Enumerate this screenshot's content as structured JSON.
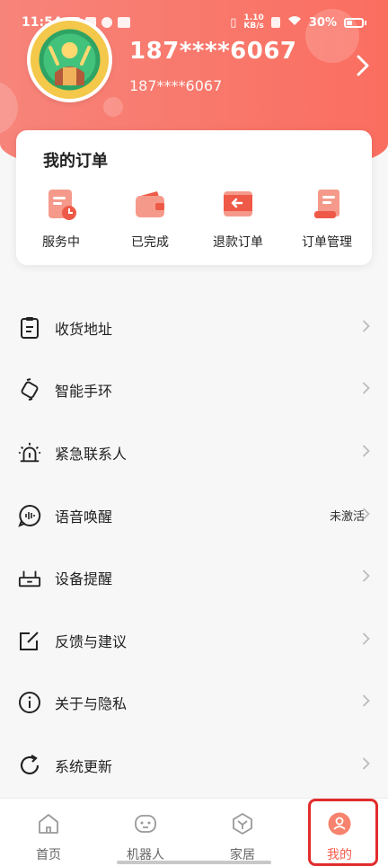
{
  "status_bar": {
    "time": "11:54",
    "speed": "1.10",
    "speed_unit": "KB/s",
    "battery": "30%"
  },
  "profile": {
    "phone_main": "187****6067",
    "phone_sub": "187****6067"
  },
  "orders": {
    "title": "我的订单",
    "items": [
      {
        "label": "服务中",
        "icon": "service-in-progress-icon"
      },
      {
        "label": "已完成",
        "icon": "completed-wallet-icon"
      },
      {
        "label": "退款订单",
        "icon": "refund-icon"
      },
      {
        "label": "订单管理",
        "icon": "order-management-icon"
      }
    ]
  },
  "menu": {
    "items": [
      {
        "label": "收货地址",
        "icon": "clipboard-icon",
        "status": ""
      },
      {
        "label": "智能手环",
        "icon": "smart-band-icon",
        "status": ""
      },
      {
        "label": "紧急联系人",
        "icon": "alarm-light-icon",
        "status": ""
      },
      {
        "label": "语音唤醒",
        "icon": "voice-icon",
        "status": "未激活"
      },
      {
        "label": "设备提醒",
        "icon": "device-icon",
        "status": ""
      },
      {
        "label": "反馈与建议",
        "icon": "feedback-edit-icon",
        "status": ""
      },
      {
        "label": "关于与隐私",
        "icon": "info-icon",
        "status": ""
      },
      {
        "label": "系统更新",
        "icon": "refresh-icon",
        "status": ""
      }
    ]
  },
  "bottom_nav": {
    "items": [
      {
        "label": "首页",
        "icon": "home-icon",
        "active": false
      },
      {
        "label": "机器人",
        "icon": "robot-icon",
        "active": false
      },
      {
        "label": "家居",
        "icon": "home-device-icon",
        "active": false
      },
      {
        "label": "我的",
        "icon": "user-icon",
        "active": true
      }
    ]
  },
  "colors": {
    "accent": "#f45c4a",
    "header_gradient_start": "#f7847a",
    "header_gradient_end": "#fa6e60",
    "highlight_border": "#e12c2c"
  }
}
